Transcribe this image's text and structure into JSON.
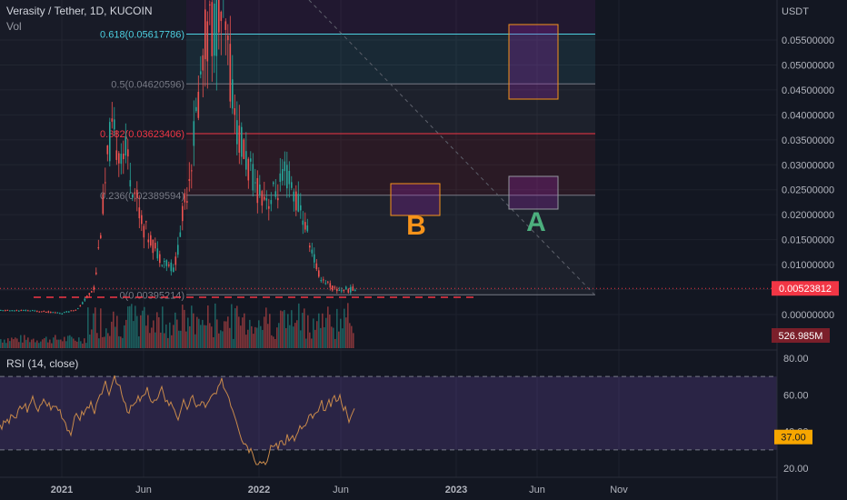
{
  "header": {
    "title": "Verasity / Tether, 1D, KUCOIN",
    "volume_label": "Vol"
  },
  "price_axis": {
    "unit": "USDT",
    "ticks": [
      "0.05500000",
      "0.05000000",
      "0.04500000",
      "0.04000000",
      "0.03500000",
      "0.03000000",
      "0.02500000",
      "0.02000000",
      "0.01500000",
      "0.01000000",
      "0.00500000",
      "0.00000000"
    ],
    "current_price": "0.00523812",
    "volume_badge": "526.985M"
  },
  "time_axis": {
    "ticks": [
      "2021",
      "Jun",
      "2022",
      "Jun",
      "2023",
      "Jun",
      "Nov"
    ]
  },
  "fib_labels": [
    {
      "level": 0.618,
      "text": "0.618(0.05617786)",
      "color": "#4dd0e1"
    },
    {
      "level": 0.5,
      "text": "0.5(0.04620596)",
      "color": "#787b86"
    },
    {
      "level": 0.382,
      "text": "0.382(0.03623406)",
      "color": "#f23645"
    },
    {
      "level": 0.236,
      "text": "0.236(0.02389594)",
      "color": "#787b86"
    },
    {
      "level": 0,
      "text": "0(0.00395214)",
      "color": "#787b86"
    }
  ],
  "annotations": {
    "label_a": "A",
    "label_b": "B",
    "color_a": "#4caf7d",
    "color_b": "#f7931a"
  },
  "rsi": {
    "label": "RSI (14, close)",
    "ticks": [
      "80.00",
      "60.00",
      "40.00",
      "20.00"
    ],
    "current": "37.00",
    "upper": 70,
    "lower": 30,
    "line_color": "#c98a4b"
  },
  "chart_data": {
    "type": "line",
    "title": "Verasity / Tether, 1D, KUCOIN",
    "ylabel": "USDT",
    "ylim": [
      0.0,
      0.0597
    ],
    "x": [
      "2020-11",
      "2021-01",
      "2021-02",
      "2021-03",
      "2021-04",
      "2021-05",
      "2021-06",
      "2021-07",
      "2021-08",
      "2021-09",
      "2021-10",
      "2021-11",
      "2021-12",
      "2022-01",
      "2022-02",
      "2022-03",
      "2022-04",
      "2022-05",
      "2022-06"
    ],
    "series": [
      {
        "values": [
          0.0008,
          0.0003,
          0.0012,
          0.0055,
          0.036,
          0.032,
          0.018,
          0.012,
          0.009,
          0.03,
          0.057,
          0.06,
          0.036,
          0.026,
          0.023,
          0.028,
          0.02,
          0.008,
          0.005
        ]
      }
    ],
    "fibonacci": [
      {
        "level": 0,
        "price": 0.00395214
      },
      {
        "level": 0.236,
        "price": 0.02389594
      },
      {
        "level": 0.382,
        "price": 0.03623406
      },
      {
        "level": 0.5,
        "price": 0.04620596
      },
      {
        "level": 0.618,
        "price": 0.05617786
      }
    ],
    "current_price": 0.00523812,
    "volume_current": "526.985M",
    "rsi": {
      "period": 14,
      "current": 37.0,
      "ylim": [
        20,
        80
      ],
      "bands": [
        30,
        70
      ]
    }
  }
}
